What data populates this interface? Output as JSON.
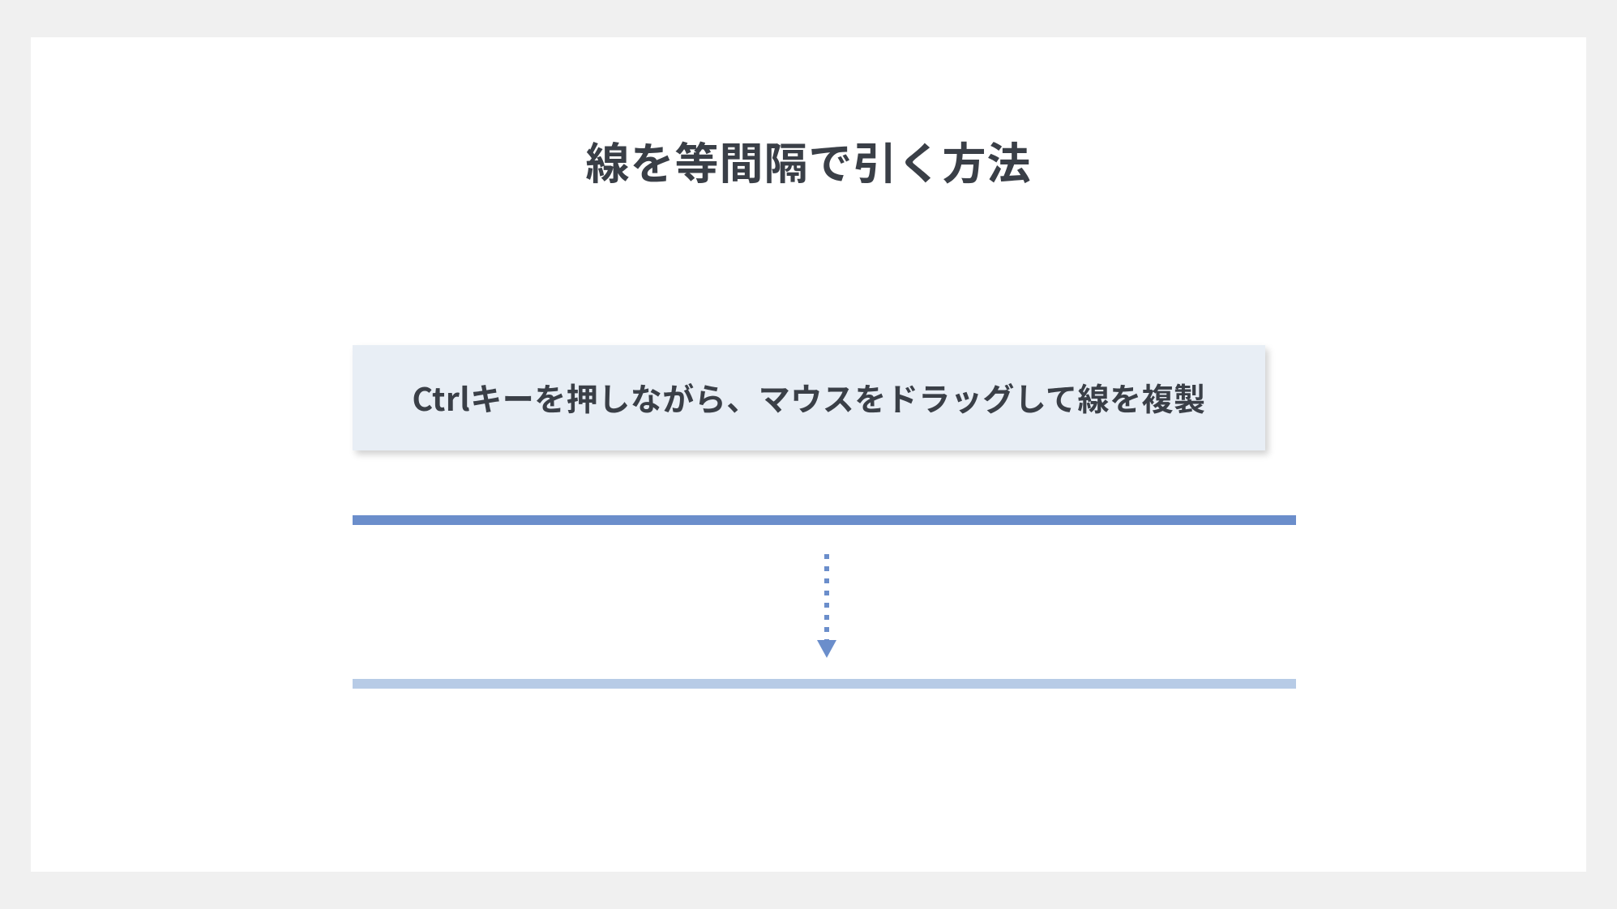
{
  "title": "線を等間隔で引く方法",
  "callout": "Ctrlキーを押しながら、マウスをドラッグして線を複製",
  "colors": {
    "line_primary": "#6b8ecb",
    "line_light": "#b7cbe6",
    "callout_bg": "#e8eef5",
    "text": "#3a3f47"
  }
}
